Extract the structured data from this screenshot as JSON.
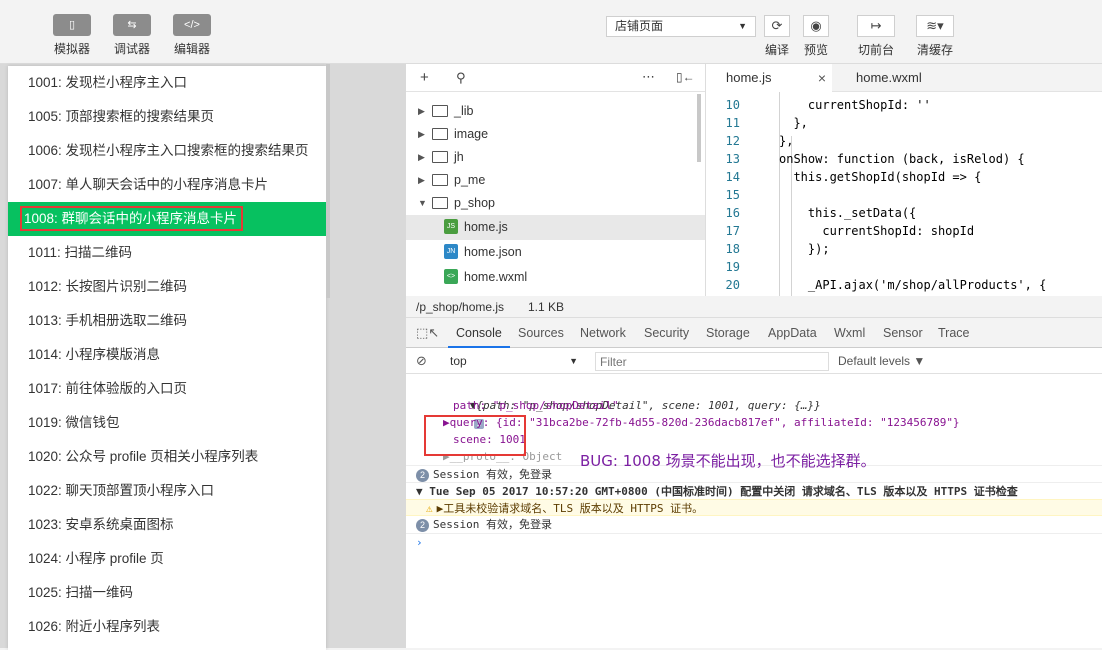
{
  "toolbar": {
    "simulator": "模拟器",
    "debugger": "调试器",
    "editor": "编辑器",
    "page_select": "店铺页面",
    "compile": "编译",
    "preview": "预览",
    "switch_bg": "切前台",
    "clear_cache": "清缓存"
  },
  "scenes": [
    "1001: 发现栏小程序主入口",
    "1005: 顶部搜索框的搜索结果页",
    "1006: 发现栏小程序主入口搜索框的搜索结果页",
    "1007: 单人聊天会话中的小程序消息卡片",
    "1008: 群聊会话中的小程序消息卡片",
    "1011: 扫描二维码",
    "1012: 长按图片识别二维码",
    "1013: 手机相册选取二维码",
    "1014: 小程序模版消息",
    "1017: 前往体验版的入口页",
    "1019: 微信钱包",
    "1020: 公众号 profile 页相关小程序列表",
    "1022: 聊天顶部置顶小程序入口",
    "1023: 安卓系统桌面图标",
    "1024: 小程序 profile 页",
    "1025: 扫描一维码",
    "1026: 附近小程序列表"
  ],
  "tree": {
    "folders": [
      "_lib",
      "image",
      "jh",
      "p_me",
      "p_shop"
    ],
    "files": [
      {
        "name": "home.js",
        "tag": "JS",
        "color": "#4a9d3f"
      },
      {
        "name": "home.json",
        "tag": "JN",
        "color": "#2d88c7"
      },
      {
        "name": "home.wxml",
        "tag": "<>",
        "color": "#3aa757"
      }
    ]
  },
  "editor": {
    "tabs": [
      "home.js",
      "home.wxml"
    ],
    "close": "×",
    "lines": [
      {
        "n": "10",
        "t": "    currentShopId: ''"
      },
      {
        "n": "11",
        "t": "  },"
      },
      {
        "n": "12",
        "t": "},"
      },
      {
        "n": "13",
        "t": "onShow: function (back, isRelod) {"
      },
      {
        "n": "14",
        "t": "  this.getShopId(shopId => {"
      },
      {
        "n": "15",
        "t": ""
      },
      {
        "n": "16",
        "t": "    this._setData({"
      },
      {
        "n": "17",
        "t": "      currentShopId: shopId"
      },
      {
        "n": "18",
        "t": "    });"
      },
      {
        "n": "19",
        "t": ""
      },
      {
        "n": "20",
        "t": "    _API.ajax('m/shop/allProducts', {"
      }
    ]
  },
  "status": {
    "path": "/p_shop/home.js",
    "size": "1.1 KB"
  },
  "devtools": {
    "tabs": [
      "Console",
      "Sources",
      "Network",
      "Security",
      "Storage",
      "AppData",
      "Wxml",
      "Sensor",
      "Trace"
    ],
    "context": "top",
    "filter_placeholder": "Filter",
    "levels": "Default levels ▼",
    "console": {
      "obj_summary": "▼{path: \"p_shop/shopDetail\", scene: 1001, query: {…}}",
      "path_line": "path: \"p_shop/shopDetail\"",
      "query_line": "▶query: {id: \"31bca2be-72fb-4d55-820d-236dacb817ef\", affiliateId: \"123456789\"}",
      "scene_line": "scene: 1001",
      "proto_line": "▶__proto__: Object",
      "session1": "Session 有效，免登录",
      "group_line": "▼ Tue Sep 05 2017 10:57:20 GMT+0800 (中国标准时间) 配置中关闭 请求域名、TLS 版本以及 HTTPS 证书检查",
      "warn_line": "▶工具未校验请求域名、TLS 版本以及 HTTPS 证书。",
      "session2": "Session 有效，免登录",
      "badge": "2",
      "prompt": "›"
    }
  },
  "bug_note": "BUG: 1008 场景不能出现，也不能选择群。"
}
